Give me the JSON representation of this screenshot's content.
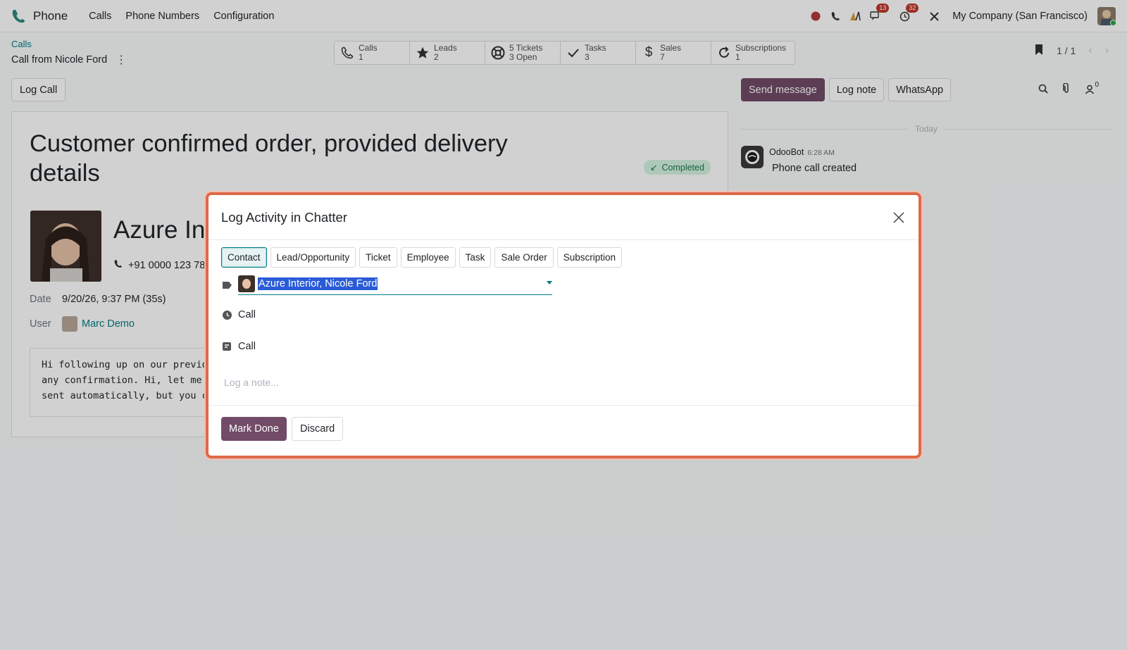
{
  "navbar": {
    "app_name": "Phone",
    "menu": [
      "Calls",
      "Phone Numbers",
      "Configuration"
    ],
    "badges": {
      "messages": "13",
      "activities": "32"
    },
    "company": "My Company (San Francisco)"
  },
  "breadcrumb": {
    "parent": "Calls",
    "current": "Call from Nicole Ford"
  },
  "smart_buttons": [
    {
      "icon": "phone-icon",
      "line1": "Calls",
      "line2": "1"
    },
    {
      "icon": "star-icon",
      "line1": "Leads",
      "line2": "2"
    },
    {
      "icon": "lifebuoy-icon",
      "line1": "5 Tickets",
      "line2": "3 Open"
    },
    {
      "icon": "check-icon",
      "line1": "Tasks",
      "line2": "3"
    },
    {
      "icon": "dollar-icon",
      "line1": "Sales",
      "line2": "7"
    },
    {
      "icon": "refresh-icon",
      "line1": "Subscriptions",
      "line2": "1"
    }
  ],
  "pager": {
    "value": "1 / 1"
  },
  "form": {
    "log_call_label": "Log Call",
    "title": "Customer confirmed order, provided delivery details",
    "status": "Completed",
    "partner_name": "Azure Interior, Nicole Ford",
    "partner_phone": "+91 0000 123 789",
    "date_label": "Date",
    "date_value": "9/20/26, 9:37 PM (35s)",
    "user_label": "User",
    "user_value": "Marc Demo",
    "notes": "Hi following up on our previous conversation. Did you receive\nany confirmation. Hi, let me know. This message was\nsent automatically, but you can reply."
  },
  "chatter": {
    "send_message": "Send message",
    "log_note": "Log note",
    "whatsapp": "WhatsApp",
    "followers_count": "0",
    "today": "Today",
    "message": {
      "author": "OdooBot",
      "time": "6:28 AM",
      "body": "Phone call created"
    }
  },
  "modal": {
    "title": "Log Activity in Chatter",
    "tabs": [
      "Contact",
      "Lead/Opportunity",
      "Ticket",
      "Employee",
      "Task",
      "Sale Order",
      "Subscription"
    ],
    "active_tab": "Contact",
    "record_value": "Azure Interior, Nicole Ford",
    "activity_type": "Call",
    "summary": "Call",
    "note_placeholder": "Log a note...",
    "mark_done": "Mark Done",
    "discard": "Discard"
  },
  "colors": {
    "primary": "#714b67",
    "accent": "#017e84",
    "highlight_border": "#dd6a4a"
  }
}
